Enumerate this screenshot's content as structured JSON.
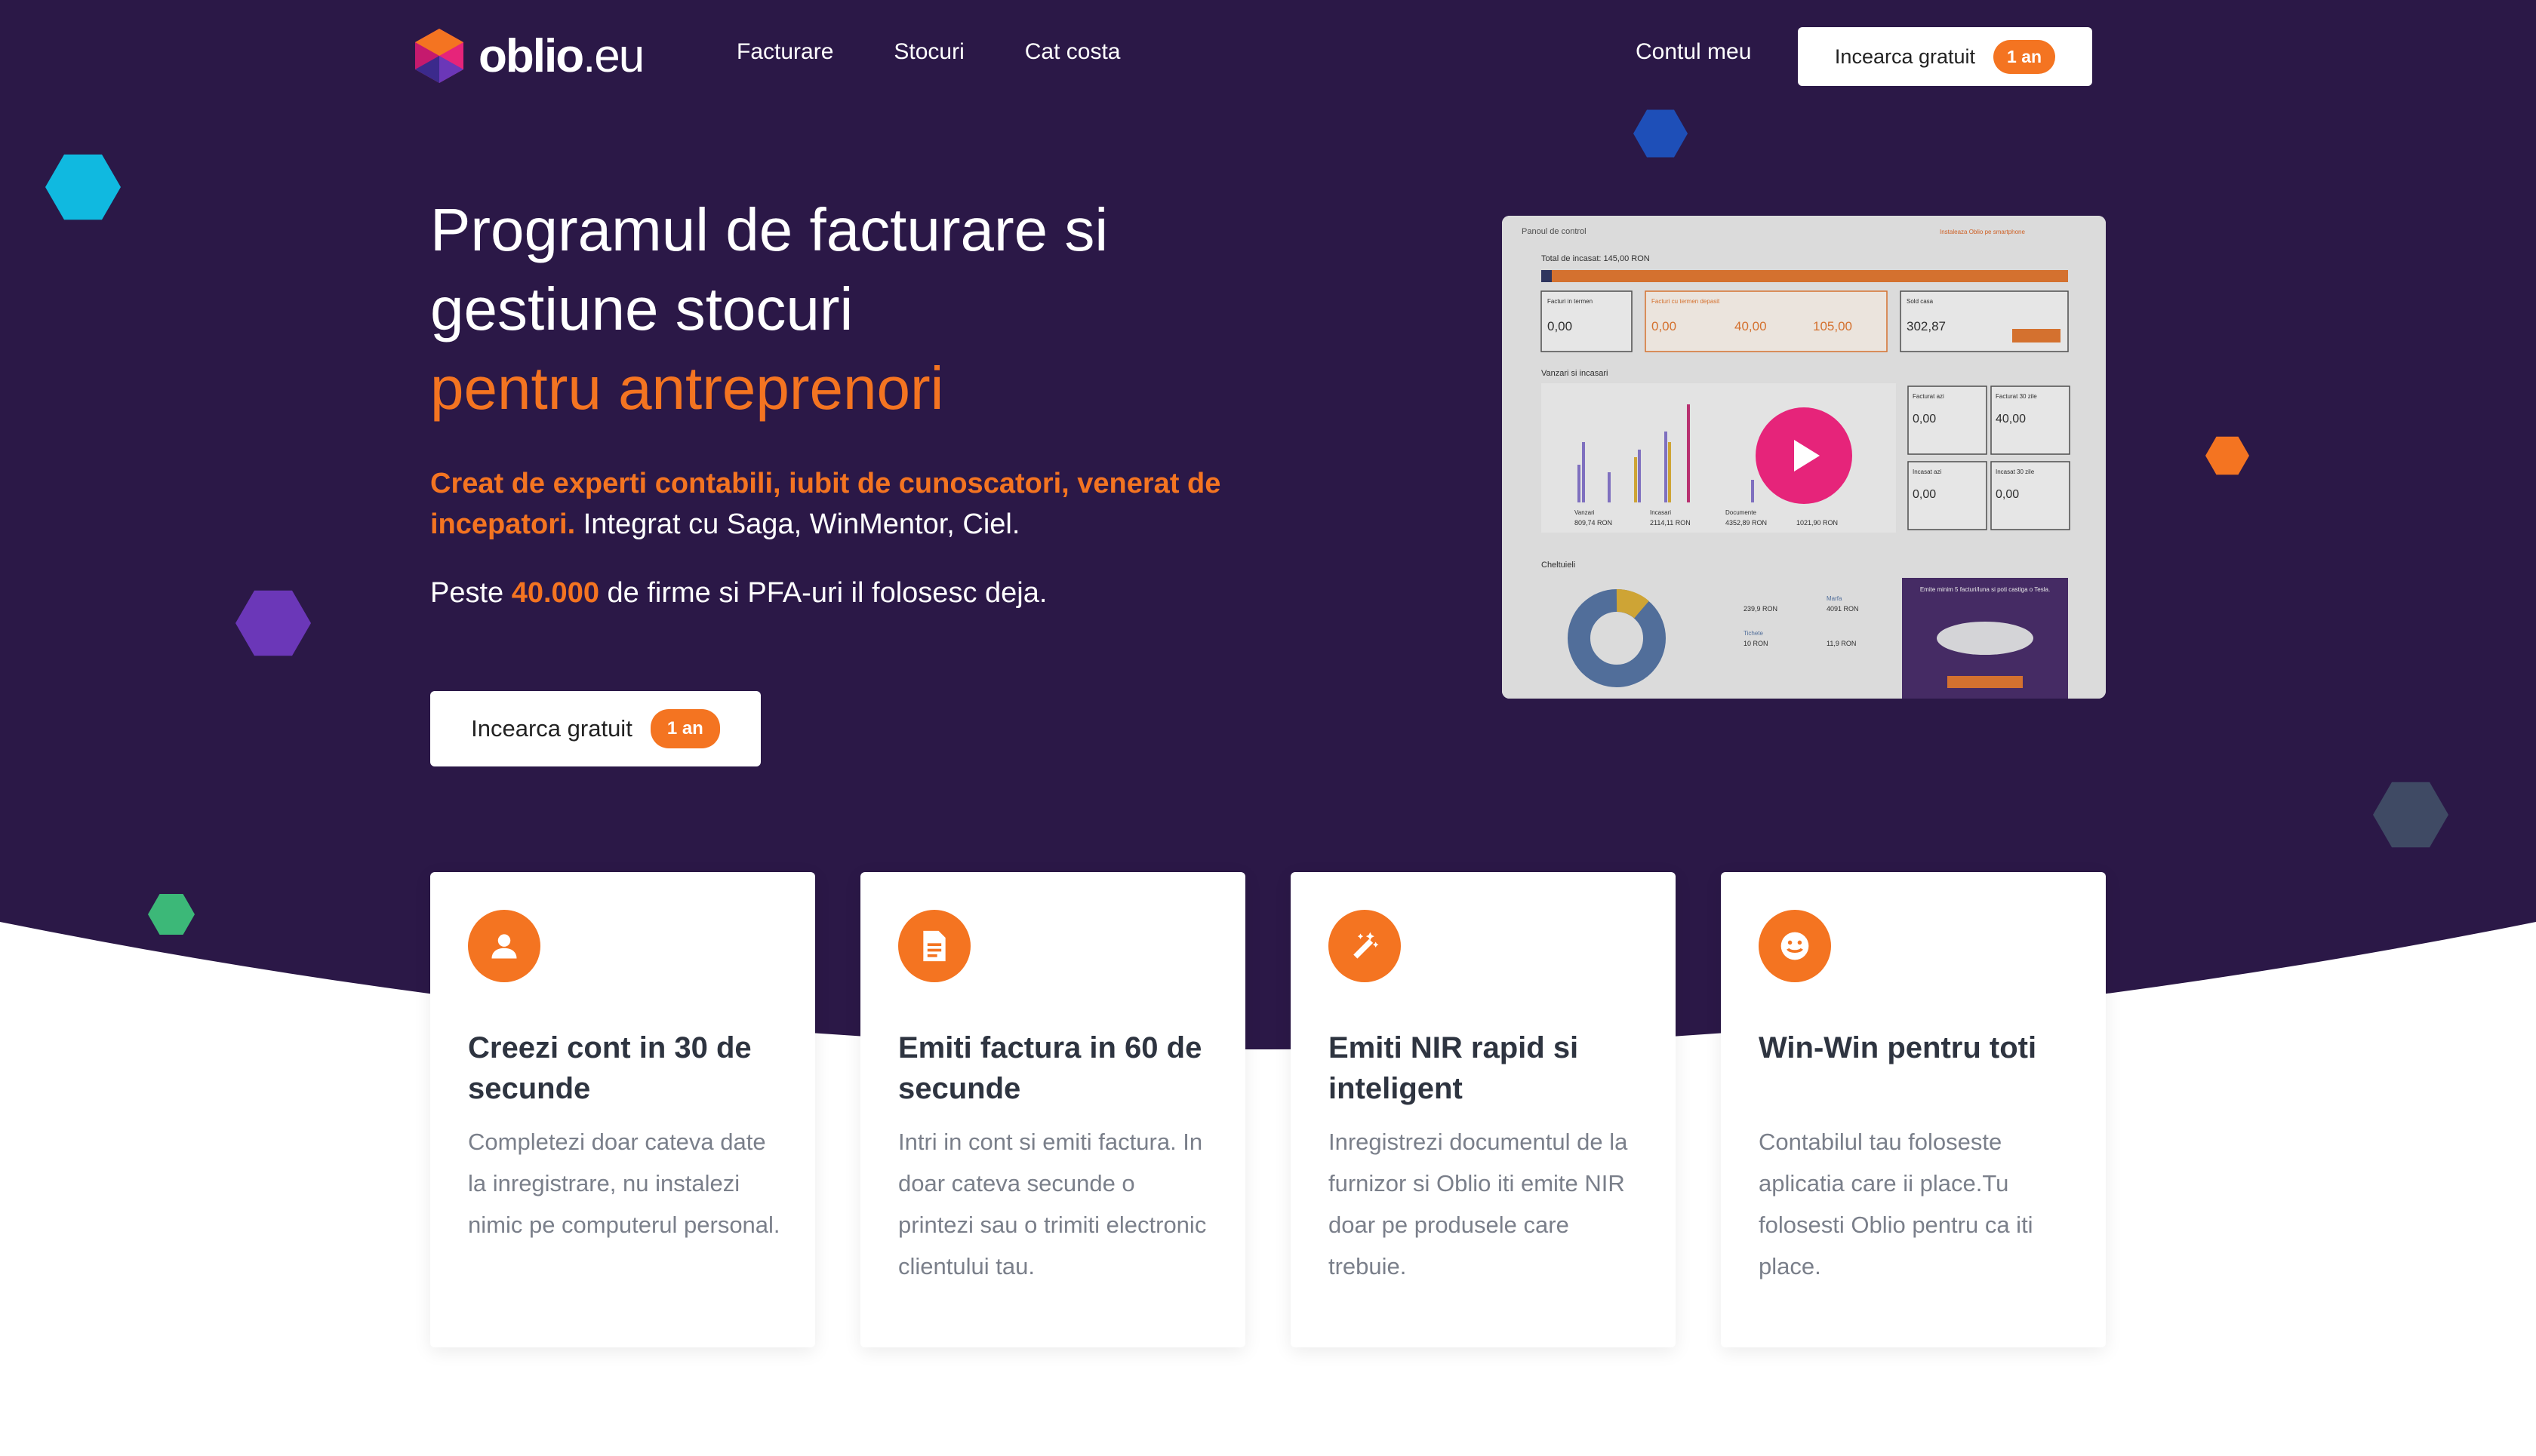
{
  "header": {
    "logo_name": "oblio",
    "logo_tld": ".eu",
    "nav": [
      {
        "label": "Facturare"
      },
      {
        "label": "Stocuri"
      },
      {
        "label": "Cat costa"
      }
    ],
    "account_label": "Contul meu",
    "cta_label": "Incearca gratuit",
    "cta_badge": "1 an"
  },
  "hero": {
    "title_line1": "Programul de facturare si",
    "title_line2": "gestiune stocuri",
    "title_accent": "pentru antreprenori",
    "tagline_accent": "Creat de experti contabili, iubit de cunoscatori, venerat de incepatori.",
    "tagline_rest": " Integrat cu Saga, WinMentor, Ciel.",
    "users_prefix": "Peste ",
    "users_count": "40.000",
    "users_suffix": " de firme si PFA-uri il folosesc deja.",
    "cta_label": "Incearca gratuit",
    "cta_badge": "1 an"
  },
  "video_preview": {
    "breadcrumb": "Panoul de control",
    "notice": "Instaleaza Oblio pe smartphone",
    "total_label": "Total de incasat: 145,00 RON",
    "cards": [
      {
        "title": "Facturi in termen",
        "value": "0,00"
      },
      {
        "title": "Facturi cu termen depasit",
        "value": "0,00"
      },
      {
        "title": "",
        "value": "40,00"
      },
      {
        "title": "",
        "value": "105,00"
      },
      {
        "title": "Sold casa",
        "value": "302,87"
      }
    ],
    "sales_title": "Vanzari si incasari",
    "sales_stats": [
      {
        "title": "Facturat azi",
        "value": "0,00"
      },
      {
        "title": "Facturat 30 zile",
        "value": "40,00"
      },
      {
        "title": "Incasat azi",
        "value": "0,00"
      },
      {
        "title": "Incasat 30 zile",
        "value": "0,00"
      }
    ],
    "legend": [
      {
        "label": "Vanzari",
        "value": "809,74 RON"
      },
      {
        "label": "Incasari",
        "value": "2114,11 RON"
      },
      {
        "label": "Documente",
        "value": "4352,89 RON"
      },
      {
        "label": "",
        "value": "1021,90 RON"
      }
    ],
    "expenses_title": "Cheltuieli",
    "expenses_legend": [
      {
        "label": "Marfa",
        "value": "4091 RON"
      },
      {
        "label": "Tichete",
        "value": "10 RON"
      },
      {
        "label": "",
        "value": "239,9 RON"
      },
      {
        "label": "",
        "value": "11,9 RON"
      }
    ],
    "promo": "Emite minim 5 facturi/luna si poti castiga o Tesla."
  },
  "features": [
    {
      "icon": "user-icon",
      "title": "Creezi cont in 30 de secunde",
      "text": "Completezi doar cateva date la inregistrare, nu instalezi nimic pe computerul personal."
    },
    {
      "icon": "document-icon",
      "title": "Emiti factura in 60 de secunde",
      "text": "Intri in cont si emiti factura. In doar cateva secunde o printezi sau o trimiti electronic clientului tau."
    },
    {
      "icon": "magic-wand-icon",
      "title": "Emiti NIR rapid si inteligent",
      "text": "Inregistrezi documentul de la furnizor si Oblio iti emite NIR doar pe produsele care trebuie."
    },
    {
      "icon": "smile-icon",
      "title": "Win-Win pentru toti",
      "text": "Contabilul tau foloseste aplicatia care ii place.Tu folosesti Oblio pentru ca iti place."
    }
  ],
  "colors": {
    "hero_bg": "#2b1847",
    "accent": "#f47421",
    "play": "#e6247a"
  }
}
